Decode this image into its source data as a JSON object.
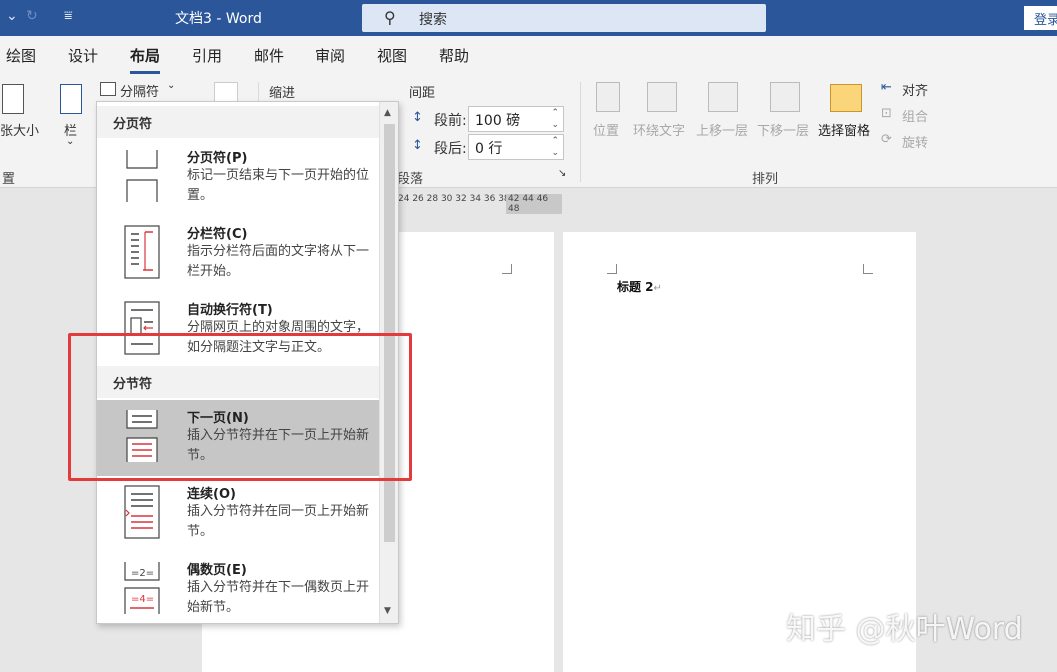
{
  "titlebar": {
    "doc_title": "文档3  -  Word",
    "search_placeholder": "搜索",
    "login_label": "登录"
  },
  "menu": {
    "tabs": [
      "绘图",
      "设计",
      "布局",
      "引用",
      "邮件",
      "审阅",
      "视图",
      "帮助"
    ],
    "active": "布局"
  },
  "ribbon": {
    "size_label": "张大小",
    "columns_label": "栏",
    "left_group_label": "置",
    "breaks_label": "分隔符",
    "indent_label": "缩进",
    "spacing_label": "间距",
    "before_label": "段前:",
    "before_value": "100 磅",
    "after_label": "段后:",
    "after_value": "0 行",
    "paragraph_group_label": "段落",
    "position_label": "位置",
    "wrap_label": "环绕文字",
    "forward_label": "上移一层",
    "backward_label": "下移一层",
    "selection_pane_label": "选择窗格",
    "align_label": "对齐",
    "group_label": "组合",
    "rotate_label": "旋转",
    "arrange_group_label": "排列"
  },
  "ruler": {
    "ticks_light": "24 26 28 30 32 34 36 38",
    "ticks_dark": "42 44 46 48"
  },
  "document": {
    "heading": "标题 2",
    "paragraph_mark": "↵"
  },
  "breaks_menu": {
    "page_breaks_header": "分页符",
    "section_breaks_header": "分节符",
    "items": [
      {
        "title": "分页符(P)",
        "desc": "标记一页结束与下一页开始的位置。"
      },
      {
        "title": "分栏符(C)",
        "desc": "指示分栏符后面的文字将从下一栏开始。"
      },
      {
        "title": "自动换行符(T)",
        "desc": "分隔网页上的对象周围的文字，如分隔题注文字与正文。"
      },
      {
        "title": "下一页(N)",
        "desc": "插入分节符并在下一页上开始新节。"
      },
      {
        "title": "连续(O)",
        "desc": "插入分节符并在同一页上开始新节。"
      },
      {
        "title": "偶数页(E)",
        "desc": "插入分节符并在下一偶数页上开始新节。"
      }
    ],
    "hovered_item": "下一页(N)",
    "even_page_thumb_top": "=2=",
    "even_page_thumb_bottom": "=4="
  },
  "watermark": "知乎 @秋叶Word",
  "colors": {
    "title_bar": "#2b579a",
    "highlight": "#e33b3b",
    "hover": "#c6c6c6",
    "break_line": "#d9363e"
  }
}
